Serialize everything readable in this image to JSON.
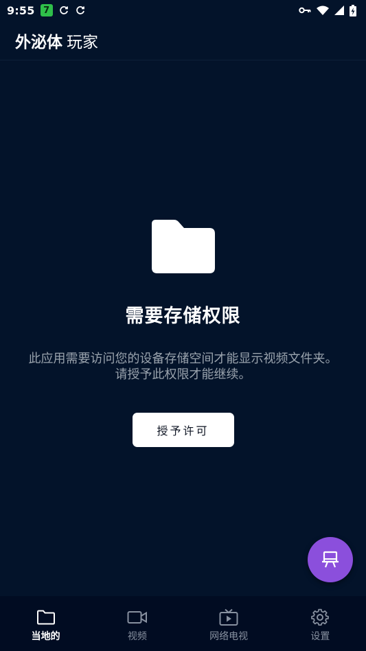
{
  "status_bar": {
    "time": "9:55",
    "badge": "7",
    "icons": [
      "sync-icon",
      "sync-icon",
      "vpn-key-icon",
      "wifi-icon",
      "signal-icon",
      "battery-charging-icon"
    ]
  },
  "app_bar": {
    "title_bold": "外泌体",
    "title_regular": "玩家"
  },
  "permission": {
    "icon": "folder-icon",
    "title": "需要存储权限",
    "description": "此应用需要访问您的设备存储空间才能显示视频文件夹。请授予此权限才能继续。",
    "button_label": "授予许可"
  },
  "fab": {
    "icon": "cast-screen-icon"
  },
  "bottom_nav": {
    "items": [
      {
        "label": "当地的",
        "icon": "folder-icon",
        "active": true
      },
      {
        "label": "视频",
        "icon": "video-camera-icon",
        "active": false
      },
      {
        "label": "网络电视",
        "icon": "tv-icon",
        "active": false
      },
      {
        "label": "设置",
        "icon": "gear-icon",
        "active": false
      }
    ]
  },
  "colors": {
    "background": "#03132a",
    "nav_background": "#010c22",
    "fab": "#8b4fdc",
    "badge_green": "#2fbf4a",
    "muted_text": "#9aa3ad"
  }
}
